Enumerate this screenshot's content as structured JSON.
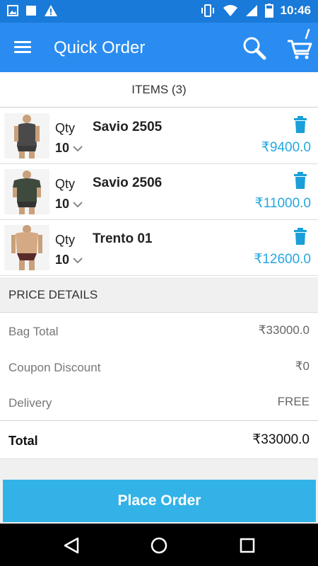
{
  "status_bar": {
    "time": "10:46",
    "left_icons": [
      "image-icon",
      "square-icon",
      "warning-icon"
    ],
    "right_icons": [
      "vibrate-icon",
      "wifi-icon",
      "signal-icon",
      "battery-icon"
    ]
  },
  "app_bar": {
    "title": "Quick Order",
    "menu_icon": "hamburger-menu-icon",
    "search_icon": "search-icon",
    "cart_icon": "cart-icon"
  },
  "items": {
    "header": "ITEMS (3)",
    "list": [
      {
        "qty_label": "Qty",
        "qty": "10",
        "name": "Savio 2505",
        "price": "₹9400.0"
      },
      {
        "qty_label": "Qty",
        "qty": "10",
        "name": "Savio 2506",
        "price": "₹11000.0"
      },
      {
        "qty_label": "Qty",
        "qty": "10",
        "name": "Trento 01",
        "price": "₹12600.0"
      }
    ]
  },
  "price_details": {
    "header": "PRICE DETAILS",
    "rows": [
      {
        "label": "Bag Total",
        "value": "₹33000.0"
      },
      {
        "label": "Coupon Discount",
        "value": "₹0"
      },
      {
        "label": "Delivery",
        "value": "FREE"
      }
    ],
    "total_label": "Total",
    "total_value": "₹33000.0"
  },
  "actions": {
    "place_order": "Place Order"
  },
  "colors": {
    "status_bar": "#1a7ad9",
    "app_bar": "#2a8cf0",
    "price_accent": "#25a7e0",
    "place_order_button": "#33b2e8"
  }
}
